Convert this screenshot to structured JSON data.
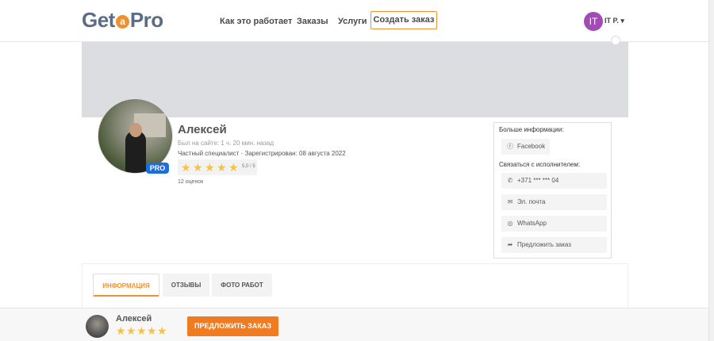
{
  "header": {
    "logo_left": "Get",
    "logo_mid": "a",
    "logo_right": "Pro",
    "nav": [
      "Как это работает",
      "Заказы",
      "Услуги"
    ],
    "create_order": "Создать заказ",
    "user_initials": "IT",
    "user_name": "IT P. ▾"
  },
  "profile": {
    "name": "Алексей",
    "online": "Был на сайте: 1 ч. 20 мин. назад",
    "type": "Частный специалист · Зарегистрирован: 08 августа 2022",
    "pro": "PRO",
    "rating_value": 5.0,
    "rating_text": "5,0 / 5",
    "stars": 5,
    "reviews": "12 оценок"
  },
  "panel": {
    "more_info": "Больше информации:",
    "facebook": "Facebook",
    "contact": "Связаться с исполнителем:",
    "phone": "+371 *** *** 04",
    "email": "Эл. почта",
    "whatsapp": "WhatsApp",
    "offer": "Предложить заказ"
  },
  "tabs": [
    "ИНФОРМАЦИЯ",
    "ОТЗЫВЫ",
    "ФОТО РАБОТ"
  ],
  "bottom": {
    "name": "Алексей",
    "button": "ПРЕДЛОЖИТЬ ЗАКАЗ"
  },
  "colors": {
    "accent": "#f0912f",
    "pro": "#1f6dd9",
    "star": "#f5c14a"
  }
}
